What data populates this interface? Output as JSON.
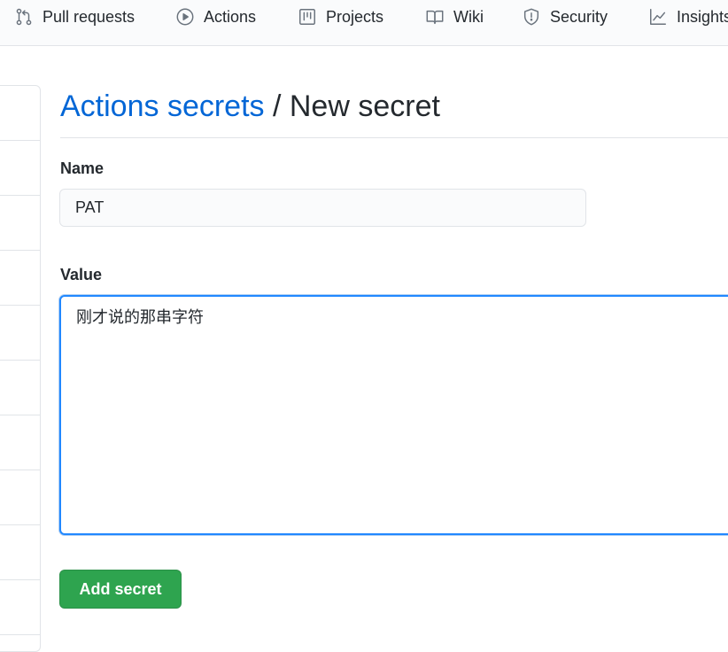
{
  "nav": {
    "items": [
      {
        "label": "Pull requests",
        "icon": "git-pull-request-icon"
      },
      {
        "label": "Actions",
        "icon": "play-icon"
      },
      {
        "label": "Projects",
        "icon": "project-icon"
      },
      {
        "label": "Wiki",
        "icon": "book-icon"
      },
      {
        "label": "Security",
        "icon": "shield-icon"
      },
      {
        "label": "Insights",
        "icon": "graph-icon"
      }
    ]
  },
  "breadcrumb": {
    "parent": "Actions secrets",
    "separator": " / ",
    "current": "New secret"
  },
  "form": {
    "name_label": "Name",
    "name_value": "PAT",
    "value_label": "Value",
    "value_text": "刚才说的那串字符",
    "submit_label": "Add secret"
  },
  "colors": {
    "link": "#0366d6",
    "primary_button": "#2ea44f",
    "focus_border": "#2188ff"
  }
}
